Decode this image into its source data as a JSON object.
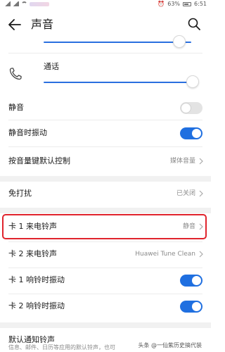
{
  "status_bar": {
    "battery_percent": "63%",
    "time": "6:51"
  },
  "header": {
    "title": "声音",
    "back_icon": "arrow-left-icon",
    "search_icon": "search-icon"
  },
  "volume": {
    "top_slider_level": 0.92,
    "call_label": "通话",
    "call_slider_level": 1.0
  },
  "rows": {
    "mute_label": "静音",
    "mute_on": false,
    "mute_vibrate_label": "静音时振动",
    "mute_vibrate_on": true,
    "volume_key_label": "按音量键默认控制",
    "volume_key_value": "媒体音量",
    "dnd_label": "免打扰",
    "dnd_value": "已关闭",
    "sim1_ringtone_label": "卡 1 来电铃声",
    "sim1_ringtone_value": "静音",
    "sim2_ringtone_label": "卡 2 来电铃声",
    "sim2_ringtone_value": "Huawei Tune Clean",
    "sim1_vibrate_label": "卡 1 响铃时振动",
    "sim1_vibrate_on": true,
    "sim2_vibrate_label": "卡 2 响铃时振动",
    "sim2_vibrate_on": true
  },
  "notification": {
    "title": "默认通知铃声",
    "subtitle": "信息、邮件、日历等应用的默认铃声，也可"
  },
  "watermark": "头条 @一仙紫历史搞代装",
  "colors": {
    "accent": "#1f6fe0",
    "highlight_border": "#e0242d"
  }
}
